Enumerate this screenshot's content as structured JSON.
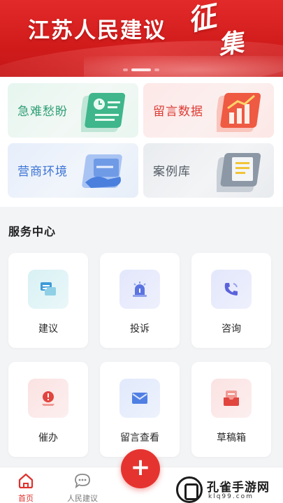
{
  "banner": {
    "title": "江苏人民建议",
    "stamp_1": "征",
    "stamp_2": "集",
    "slides": [
      {
        "active": false
      },
      {
        "active": true
      },
      {
        "active": false
      }
    ]
  },
  "quick_cards": [
    {
      "label": "急难愁盼",
      "icon": "document-clock-icon",
      "color": "#2f9e76"
    },
    {
      "label": "留言数据",
      "icon": "bar-chart-icon",
      "color": "#dd3b34"
    },
    {
      "label": "营商环境",
      "icon": "handshake-document-icon",
      "color": "#3b73d6"
    },
    {
      "label": "案例库",
      "icon": "case-file-icon",
      "color": "#555c66"
    }
  ],
  "service_center": {
    "title": "服务中心",
    "items": [
      {
        "label": "建议",
        "icon": "chat-bubbles-icon"
      },
      {
        "label": "投诉",
        "icon": "alarm-light-icon"
      },
      {
        "label": "咨询",
        "icon": "phone-icon"
      },
      {
        "label": "催办",
        "icon": "urge-icon"
      },
      {
        "label": "留言查看",
        "icon": "envelope-icon"
      },
      {
        "label": "草稿箱",
        "icon": "draft-box-icon"
      }
    ]
  },
  "tabbar": {
    "home": "首页",
    "suggestion": "人民建议",
    "fab_symbol": "+"
  },
  "watermark": {
    "brand": "孔雀手游网",
    "url": "klq99.com"
  },
  "colors": {
    "brand_red": "#e53430",
    "active_tab": "#e0302b"
  }
}
